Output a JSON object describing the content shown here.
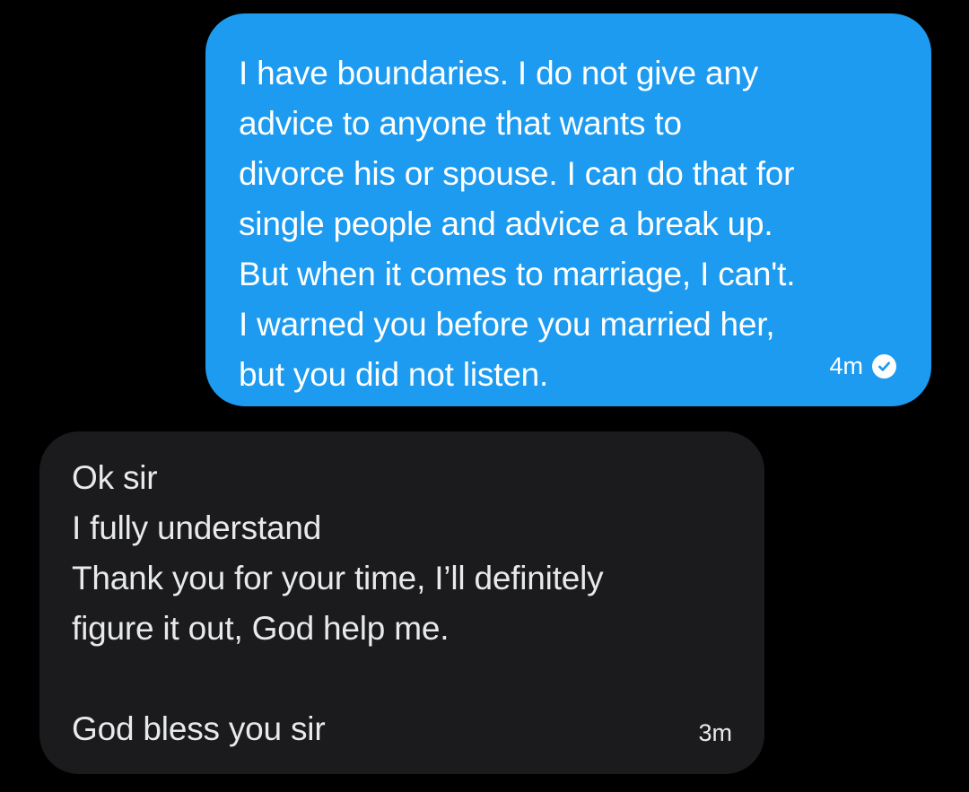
{
  "messages": {
    "sent": {
      "lines": [
        "I have boundaries. I do not give any",
        "advice to anyone that wants to",
        "divorce his or spouse. I can do that for",
        "single people and advice a break up.",
        "But when it comes to marriage, I can't.",
        "I warned you before you married her,",
        "but you did not listen."
      ],
      "time": "4m",
      "status_icon": "read-check-icon",
      "color": "#1d9bf0"
    },
    "received": {
      "lines": [
        "Ok sir",
        "I fully understand",
        "Thank you for your time, I’ll definitely",
        "figure it out, God help me.",
        "",
        "God bless you sir"
      ],
      "time": "3m",
      "color": "#1b1b1e"
    }
  }
}
